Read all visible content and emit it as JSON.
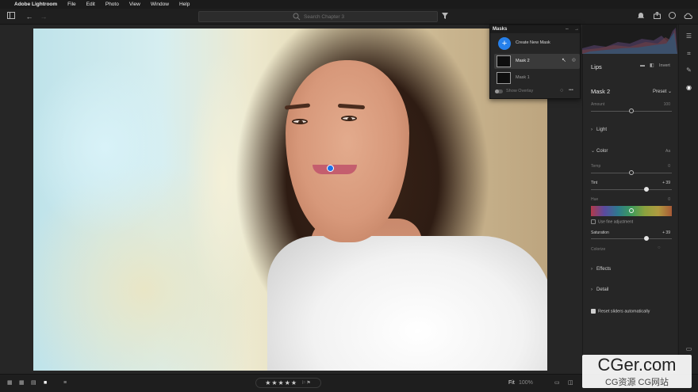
{
  "menubar": {
    "app": "Adobe Lightroom",
    "items": [
      "File",
      "Edit",
      "Photo",
      "View",
      "Window",
      "Help"
    ]
  },
  "search": {
    "placeholder": "Search Chapter 3"
  },
  "masks_panel": {
    "title": "Masks",
    "create_label": "Create New Mask",
    "items": [
      "Mask 2",
      "Mask 1"
    ],
    "overlay_label": "Show Overlay"
  },
  "panel": {
    "header": "Lips",
    "invert_label": "Invert",
    "mask_name": "Mask 2",
    "preset_label": "Preset",
    "amount": {
      "label": "Amount",
      "value": "100",
      "fraction": 0.5
    },
    "light_label": "Light",
    "color_label": "Color",
    "color_aux": "Aa",
    "temp": {
      "label": "Temp",
      "value": "0",
      "fraction": 0.5
    },
    "tint": {
      "label": "Tint",
      "value": "+ 39",
      "fraction": 0.69
    },
    "hue": {
      "label": "Hue",
      "value": "0",
      "fraction": 0.5
    },
    "fine_adjust_label": "Use fine adjustment",
    "saturation": {
      "label": "Saturation",
      "value": "+ 39",
      "fraction": 0.69
    },
    "colorize_label": "Colorize",
    "effects_label": "Effects",
    "detail_label": "Detail",
    "reset_label": "Reset sliders automatically"
  },
  "bottom": {
    "stars": "★★★★★",
    "fit_label": "Fit",
    "zoom_label": "100%"
  },
  "watermark": {
    "big": "CGer.com",
    "small": "CG资源 CG网站"
  },
  "colors": {
    "accent": "#2680eb",
    "panel_bg": "#262626",
    "chrome_bg": "#1e1e1e"
  }
}
